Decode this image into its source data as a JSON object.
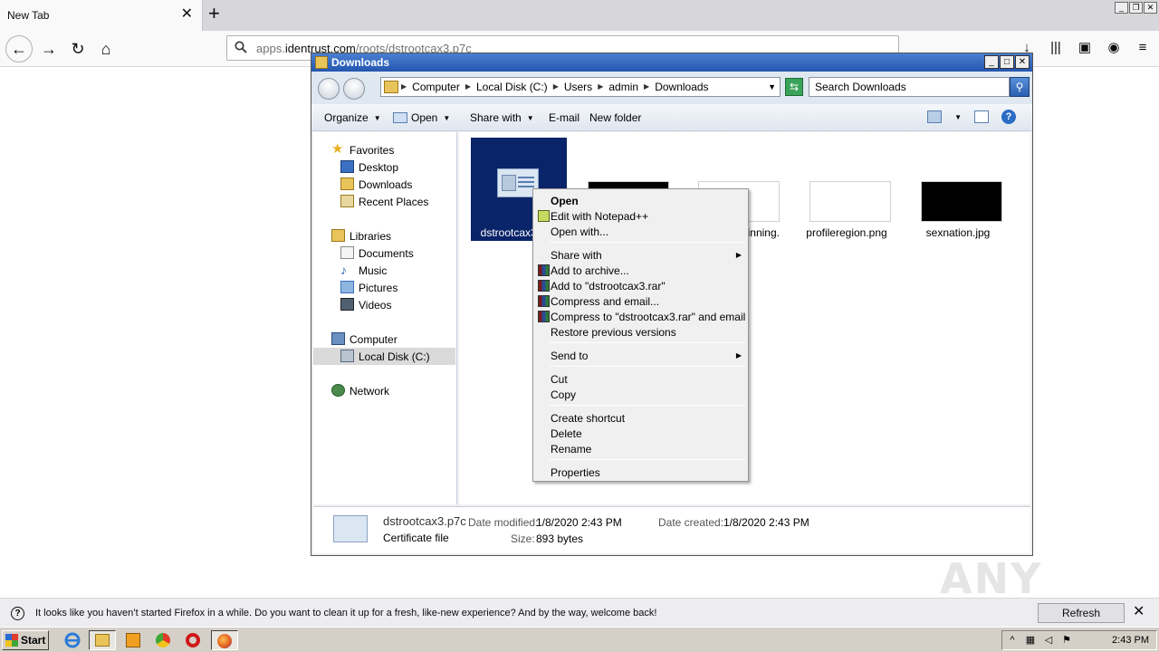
{
  "browser": {
    "tab_title": "New Tab",
    "url_prefix": "apps.",
    "url_host": "identrust.com",
    "url_path": "/roots/dstrootcax3.p7c"
  },
  "explorer": {
    "title": "Downloads",
    "breadcrumbs": [
      "Computer",
      "Local Disk (C:)",
      "Users",
      "admin",
      "Downloads"
    ],
    "search_placeholder": "Search Downloads",
    "toolbar": {
      "organize": "Organize",
      "open": "Open",
      "share_with": "Share with",
      "email": "E-mail",
      "new_folder": "New folder"
    },
    "nav": {
      "favorites": "Favorites",
      "desktop": "Desktop",
      "downloads": "Downloads",
      "recent_places": "Recent Places",
      "libraries": "Libraries",
      "documents": "Documents",
      "music": "Music",
      "pictures": "Pictures",
      "videos": "Videos",
      "computer": "Computer",
      "local_disk": "Local Disk (C:)",
      "network": "Network"
    },
    "files": [
      {
        "name": "dstrootcax3.p7c",
        "thumb_color": "#dbe6f3"
      },
      {
        "name": "",
        "thumb_color": "#000000"
      },
      {
        "name": "beginning.",
        "thumb_color": "#ffffff"
      },
      {
        "name": "profileregion.png",
        "thumb_color": "#ffffff"
      },
      {
        "name": "sexnation.jpg",
        "thumb_color": "#000000"
      }
    ],
    "details": {
      "name": "dstrootcax3.p7c",
      "type": "Certificate file",
      "date_modified_label": "Date modified:",
      "date_modified": "1/8/2020 2:43 PM",
      "date_created_label": "Date created:",
      "date_created": "1/8/2020 2:43 PM",
      "size_label": "Size:",
      "size": "893 bytes"
    }
  },
  "context_menu": {
    "open": "Open",
    "edit_npp": "Edit with Notepad++",
    "open_with": "Open with...",
    "share_with": "Share with",
    "add_archive": "Add to archive...",
    "add_rar": "Add to \"dstrootcax3.rar\"",
    "compress_email": "Compress and email...",
    "compress_rar_email": "Compress to \"dstrootcax3.rar\" and email",
    "restore": "Restore previous versions",
    "send_to": "Send to",
    "cut": "Cut",
    "copy": "Copy",
    "create_shortcut": "Create shortcut",
    "delete": "Delete",
    "rename": "Rename",
    "properties": "Properties"
  },
  "notification": {
    "message": "It looks like you haven’t started Firefox in a while. Do you want to clean it up for a fresh, like-new experience? And by the way, welcome back!",
    "button": "Refresh Firefox…"
  },
  "taskbar": {
    "start": "Start",
    "time": "2:43 PM"
  },
  "watermark": "ANY RUN",
  "colors": {
    "selection": "#0a246a",
    "title_bar": "#2456b0"
  }
}
